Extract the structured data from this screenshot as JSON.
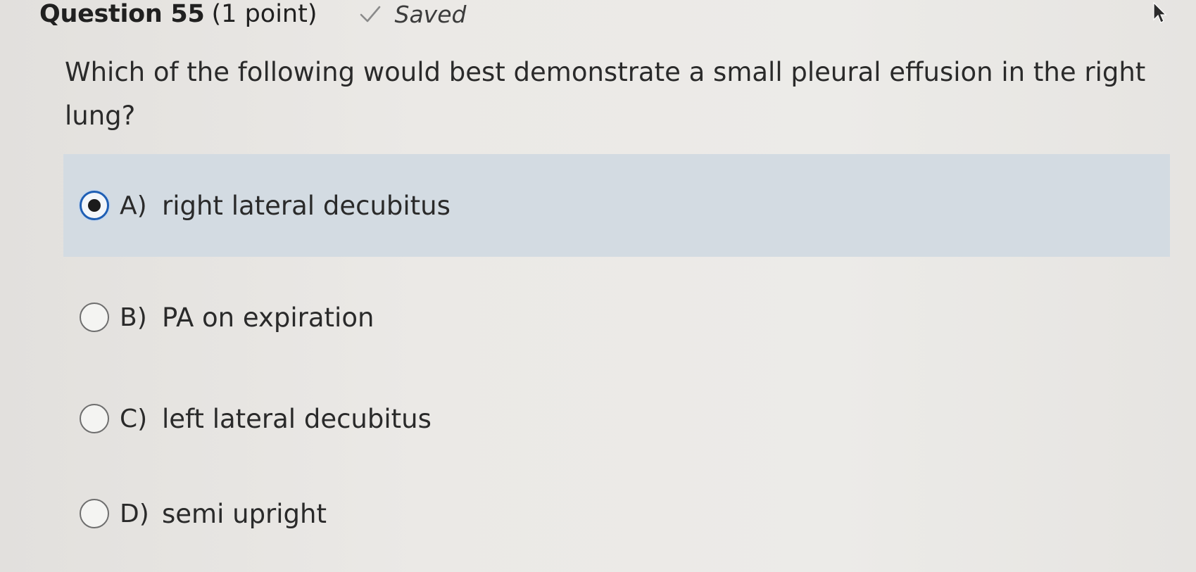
{
  "header": {
    "title": "Question 55",
    "points": "(1 point)",
    "status": "Saved"
  },
  "question": {
    "text": "Which of the following would best demonstrate a small pleural effusion in the right lung?"
  },
  "options": [
    {
      "letter": "A)",
      "text": "right lateral decubitus",
      "selected": true
    },
    {
      "letter": "B)",
      "text": "PA on expiration",
      "selected": false
    },
    {
      "letter": "C)",
      "text": "left lateral decubitus",
      "selected": false
    },
    {
      "letter": "D)",
      "text": "semi upright",
      "selected": false
    }
  ],
  "colors": {
    "selected_background": "#d3dbe2",
    "radio_selected_ring": "#1f5fb4"
  }
}
